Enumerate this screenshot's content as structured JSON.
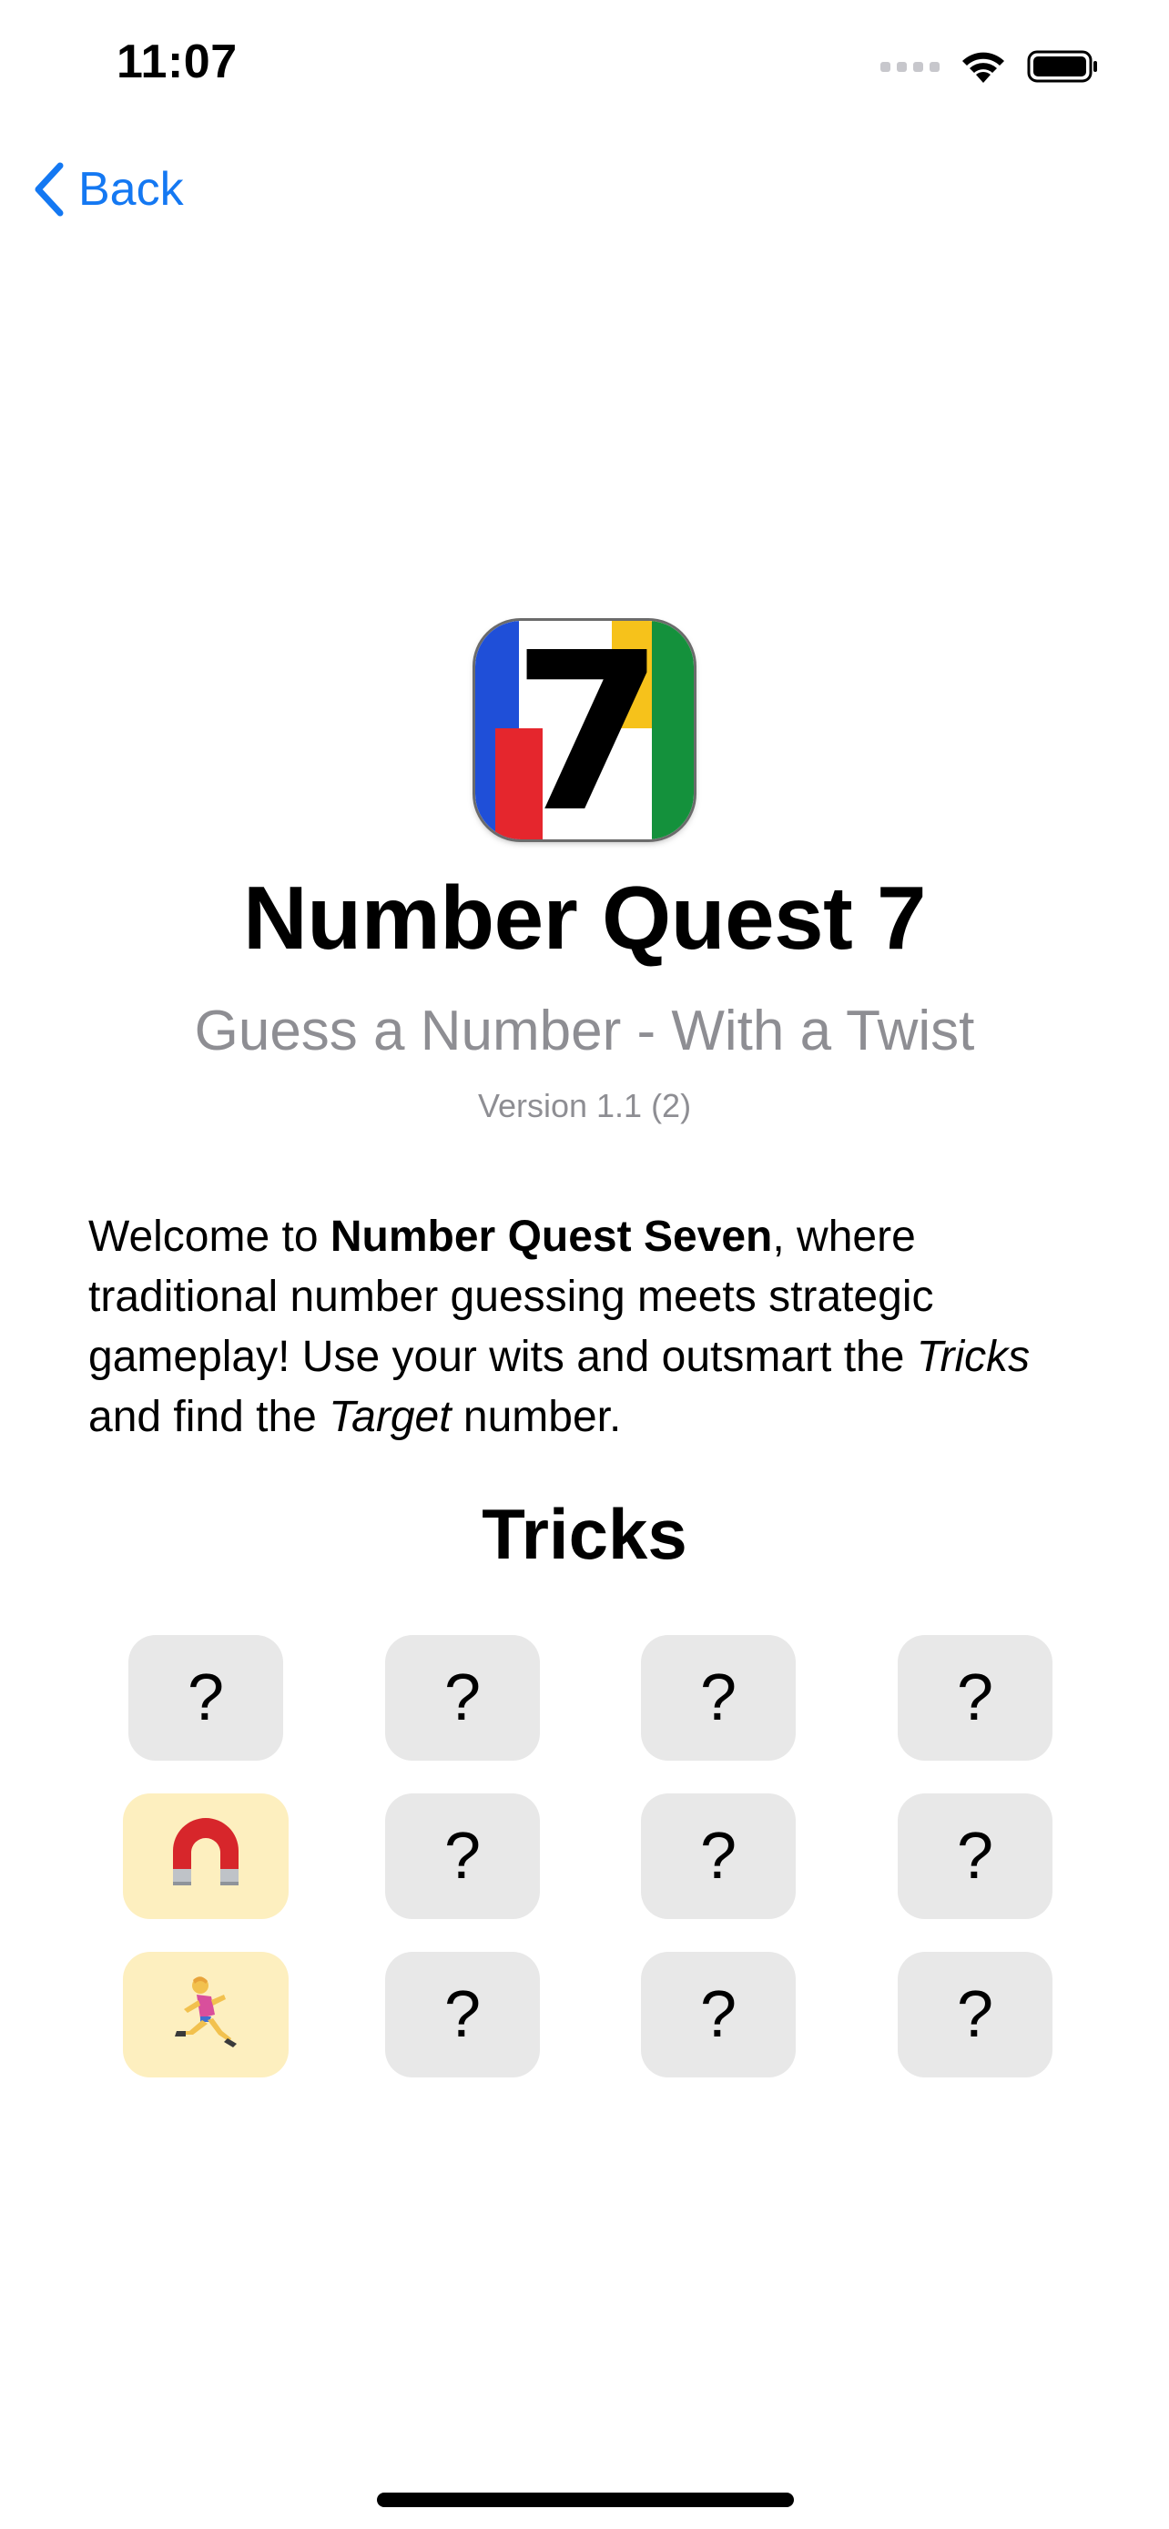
{
  "status_bar": {
    "time": "11:07"
  },
  "nav": {
    "back_label": "Back"
  },
  "app": {
    "icon_digit": "7",
    "title": "Number Quest 7",
    "subtitle": "Guess a Number - With a Twist",
    "version": "Version 1.1 (2)",
    "icon_colors": {
      "blue": "#1f4fd8",
      "red": "#e5262d",
      "yellow": "#f6c21b",
      "green": "#14913c"
    }
  },
  "description": {
    "part1": "Welcome to ",
    "bold_name": "Number Quest Seven",
    "part2": ", where traditional number guessing meets strategic gameplay! Use your wits and outsmart the ",
    "italic_tricks": "Tricks",
    "part3": " and find the ",
    "italic_target": "Target",
    "part4": " number."
  },
  "tricks": {
    "heading": "Tricks",
    "tiles": [
      {
        "label": "?",
        "icon": "unknown",
        "unlocked": false
      },
      {
        "label": "?",
        "icon": "unknown",
        "unlocked": false
      },
      {
        "label": "?",
        "icon": "unknown",
        "unlocked": false
      },
      {
        "label": "?",
        "icon": "unknown",
        "unlocked": false
      },
      {
        "label": "",
        "icon": "magnet-icon",
        "unlocked": true
      },
      {
        "label": "?",
        "icon": "unknown",
        "unlocked": false
      },
      {
        "label": "?",
        "icon": "unknown",
        "unlocked": false
      },
      {
        "label": "?",
        "icon": "unknown",
        "unlocked": false
      },
      {
        "label": "",
        "icon": "runner-icon",
        "unlocked": true
      },
      {
        "label": "?",
        "icon": "unknown",
        "unlocked": false
      },
      {
        "label": "?",
        "icon": "unknown",
        "unlocked": false
      },
      {
        "label": "?",
        "icon": "unknown",
        "unlocked": false
      }
    ]
  },
  "colors": {
    "accent": "#1478f2",
    "secondary_text": "#8e8e93",
    "tile_locked": "#e8e8e8",
    "tile_unlocked": "#fdefbf"
  }
}
